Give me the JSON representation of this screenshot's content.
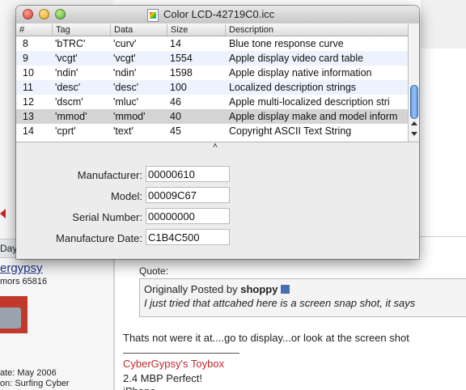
{
  "background_page": {
    "left_column": {
      "day_label": "Day",
      "username": "ergypsy",
      "rank": "mors 65816",
      "join_date": "ate: May 2006",
      "location": "on: Surfing Cyber"
    },
    "quote": {
      "label": "Quote:",
      "originally_posted_by": "Originally Posted by",
      "author": "shoppy",
      "text": "I just tried that attcahed here is a screen snap shot, it says"
    },
    "post_text": "Thats not were it at....go to display...or look at the screen shot",
    "signature": {
      "owner_prefix": "CyberGypsy's",
      "apple_glyph": "",
      "toybox": "Toybox",
      "line2": "2.4 MBP Perfect!",
      "line3": "iPhone"
    }
  },
  "window": {
    "title": "Color LCD-42719C0.icc",
    "table": {
      "columns": [
        "#",
        "Tag",
        "Data",
        "Size",
        "Description"
      ],
      "rows": [
        {
          "num": "8",
          "tag": "'bTRC'",
          "data": "'curv'",
          "size": "14",
          "desc": "Blue tone response curve"
        },
        {
          "num": "9",
          "tag": "'vcgt'",
          "data": "'vcgt'",
          "size": "1554",
          "desc": "Apple display video card table"
        },
        {
          "num": "10",
          "tag": "'ndin'",
          "data": "'ndin'",
          "size": "1598",
          "desc": "Apple display native information"
        },
        {
          "num": "11",
          "tag": "'desc'",
          "data": "'desc'",
          "size": "100",
          "desc": "Localized description strings"
        },
        {
          "num": "12",
          "tag": "'dscm'",
          "data": "'mluc'",
          "size": "46",
          "desc": "Apple multi-localized description stri"
        },
        {
          "num": "13",
          "tag": "'mmod'",
          "data": "'mmod'",
          "size": "40",
          "desc": "Apple display make and model inform"
        },
        {
          "num": "14",
          "tag": "'cprt'",
          "data": "'text'",
          "size": "45",
          "desc": "Copyright ASCII Text String"
        }
      ],
      "selected_row": "13"
    },
    "splitter_caret": "˄",
    "form": {
      "manufacturer_label": "Manufacturer:",
      "manufacturer_value": "00000610",
      "model_label": "Model:",
      "model_value": "00009C67",
      "serial_label": "Serial Number:",
      "serial_value": "00000000",
      "date_label": "Manufacture Date:",
      "date_value": "C1B4C500"
    }
  },
  "colors": {
    "accent_blue": "#4f8de0",
    "signature_red": "#c0272d",
    "username_blue": "#1c2e86",
    "row_alt": "#edf3fe",
    "row_selected": "#d4d4d4"
  }
}
